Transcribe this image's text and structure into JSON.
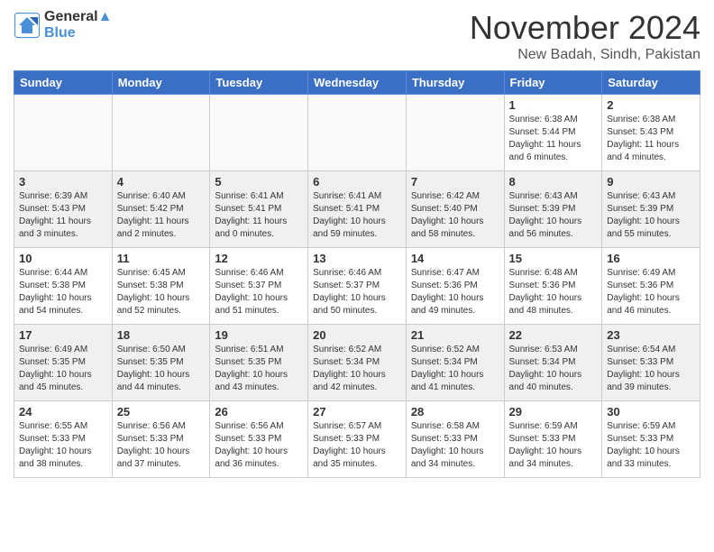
{
  "header": {
    "logo_line1": "General",
    "logo_line2": "Blue",
    "month": "November 2024",
    "location": "New Badah, Sindh, Pakistan"
  },
  "weekdays": [
    "Sunday",
    "Monday",
    "Tuesday",
    "Wednesday",
    "Thursday",
    "Friday",
    "Saturday"
  ],
  "weeks": [
    [
      {
        "day": "",
        "info": ""
      },
      {
        "day": "",
        "info": ""
      },
      {
        "day": "",
        "info": ""
      },
      {
        "day": "",
        "info": ""
      },
      {
        "day": "",
        "info": ""
      },
      {
        "day": "1",
        "info": "Sunrise: 6:38 AM\nSunset: 5:44 PM\nDaylight: 11 hours and 6 minutes."
      },
      {
        "day": "2",
        "info": "Sunrise: 6:38 AM\nSunset: 5:43 PM\nDaylight: 11 hours and 4 minutes."
      }
    ],
    [
      {
        "day": "3",
        "info": "Sunrise: 6:39 AM\nSunset: 5:43 PM\nDaylight: 11 hours and 3 minutes."
      },
      {
        "day": "4",
        "info": "Sunrise: 6:40 AM\nSunset: 5:42 PM\nDaylight: 11 hours and 2 minutes."
      },
      {
        "day": "5",
        "info": "Sunrise: 6:41 AM\nSunset: 5:41 PM\nDaylight: 11 hours and 0 minutes."
      },
      {
        "day": "6",
        "info": "Sunrise: 6:41 AM\nSunset: 5:41 PM\nDaylight: 10 hours and 59 minutes."
      },
      {
        "day": "7",
        "info": "Sunrise: 6:42 AM\nSunset: 5:40 PM\nDaylight: 10 hours and 58 minutes."
      },
      {
        "day": "8",
        "info": "Sunrise: 6:43 AM\nSunset: 5:39 PM\nDaylight: 10 hours and 56 minutes."
      },
      {
        "day": "9",
        "info": "Sunrise: 6:43 AM\nSunset: 5:39 PM\nDaylight: 10 hours and 55 minutes."
      }
    ],
    [
      {
        "day": "10",
        "info": "Sunrise: 6:44 AM\nSunset: 5:38 PM\nDaylight: 10 hours and 54 minutes."
      },
      {
        "day": "11",
        "info": "Sunrise: 6:45 AM\nSunset: 5:38 PM\nDaylight: 10 hours and 52 minutes."
      },
      {
        "day": "12",
        "info": "Sunrise: 6:46 AM\nSunset: 5:37 PM\nDaylight: 10 hours and 51 minutes."
      },
      {
        "day": "13",
        "info": "Sunrise: 6:46 AM\nSunset: 5:37 PM\nDaylight: 10 hours and 50 minutes."
      },
      {
        "day": "14",
        "info": "Sunrise: 6:47 AM\nSunset: 5:36 PM\nDaylight: 10 hours and 49 minutes."
      },
      {
        "day": "15",
        "info": "Sunrise: 6:48 AM\nSunset: 5:36 PM\nDaylight: 10 hours and 48 minutes."
      },
      {
        "day": "16",
        "info": "Sunrise: 6:49 AM\nSunset: 5:36 PM\nDaylight: 10 hours and 46 minutes."
      }
    ],
    [
      {
        "day": "17",
        "info": "Sunrise: 6:49 AM\nSunset: 5:35 PM\nDaylight: 10 hours and 45 minutes."
      },
      {
        "day": "18",
        "info": "Sunrise: 6:50 AM\nSunset: 5:35 PM\nDaylight: 10 hours and 44 minutes."
      },
      {
        "day": "19",
        "info": "Sunrise: 6:51 AM\nSunset: 5:35 PM\nDaylight: 10 hours and 43 minutes."
      },
      {
        "day": "20",
        "info": "Sunrise: 6:52 AM\nSunset: 5:34 PM\nDaylight: 10 hours and 42 minutes."
      },
      {
        "day": "21",
        "info": "Sunrise: 6:52 AM\nSunset: 5:34 PM\nDaylight: 10 hours and 41 minutes."
      },
      {
        "day": "22",
        "info": "Sunrise: 6:53 AM\nSunset: 5:34 PM\nDaylight: 10 hours and 40 minutes."
      },
      {
        "day": "23",
        "info": "Sunrise: 6:54 AM\nSunset: 5:33 PM\nDaylight: 10 hours and 39 minutes."
      }
    ],
    [
      {
        "day": "24",
        "info": "Sunrise: 6:55 AM\nSunset: 5:33 PM\nDaylight: 10 hours and 38 minutes."
      },
      {
        "day": "25",
        "info": "Sunrise: 6:56 AM\nSunset: 5:33 PM\nDaylight: 10 hours and 37 minutes."
      },
      {
        "day": "26",
        "info": "Sunrise: 6:56 AM\nSunset: 5:33 PM\nDaylight: 10 hours and 36 minutes."
      },
      {
        "day": "27",
        "info": "Sunrise: 6:57 AM\nSunset: 5:33 PM\nDaylight: 10 hours and 35 minutes."
      },
      {
        "day": "28",
        "info": "Sunrise: 6:58 AM\nSunset: 5:33 PM\nDaylight: 10 hours and 34 minutes."
      },
      {
        "day": "29",
        "info": "Sunrise: 6:59 AM\nSunset: 5:33 PM\nDaylight: 10 hours and 34 minutes."
      },
      {
        "day": "30",
        "info": "Sunrise: 6:59 AM\nSunset: 5:33 PM\nDaylight: 10 hours and 33 minutes."
      }
    ]
  ]
}
